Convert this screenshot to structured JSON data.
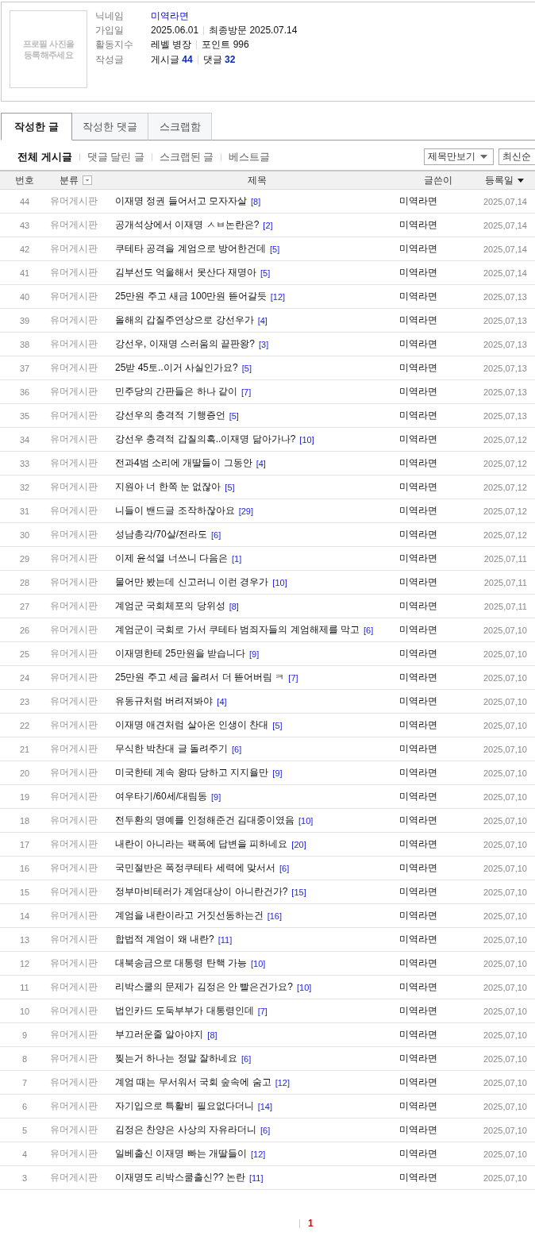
{
  "profile": {
    "photo_placeholder": "프로필 사진을 등록해주세요",
    "fields": [
      {
        "label": "닉네임",
        "kind": "link",
        "value": "미역라면"
      },
      {
        "label": "가입일",
        "kind": "parts",
        "parts": [
          "2025.06.01",
          "최종방문 2025.07.14"
        ]
      },
      {
        "label": "활동지수",
        "kind": "parts",
        "parts": [
          "레벨 병장",
          "포인트 996"
        ]
      },
      {
        "label": "작성글",
        "kind": "parts",
        "parts": [
          "게시글 **44**",
          "댓글 **32**"
        ]
      }
    ]
  },
  "tabs": [
    {
      "label": "작성한 글",
      "selected": true
    },
    {
      "label": "작성한 댓글",
      "selected": false
    },
    {
      "label": "스크랩함",
      "selected": false
    }
  ],
  "filters": [
    {
      "label": "전체 게시글",
      "selected": true
    },
    {
      "label": "댓글 달린 글",
      "selected": false
    },
    {
      "label": "스크랩된 글",
      "selected": false
    },
    {
      "label": "베스트글",
      "selected": false
    }
  ],
  "selects": [
    {
      "value": "제목만보기"
    },
    {
      "value": "최신순"
    }
  ],
  "table": {
    "columns": [
      {
        "label": "번호",
        "kind": "plain"
      },
      {
        "label": "분류",
        "kind": "filter"
      },
      {
        "label": "제목",
        "kind": "plain"
      },
      {
        "label": "글쓴이",
        "kind": "plain"
      },
      {
        "label": "등록일",
        "kind": "sort"
      }
    ],
    "rows": [
      {
        "number": "44",
        "category": "유머게시판",
        "title": "이재명 정권 들어서고 모자자살",
        "comments": "[8]",
        "author": "미역라면",
        "date": "2025,07,14"
      },
      {
        "number": "43",
        "category": "유머게시판",
        "title": "공개석상에서 이재명 ㅅㅂ논란은?",
        "comments": "[2]",
        "author": "미역라면",
        "date": "2025,07,14"
      },
      {
        "number": "42",
        "category": "유머게시판",
        "title": "쿠테타 공격을 계엄으로 방어한건데",
        "comments": "[5]",
        "author": "미역라면",
        "date": "2025,07,14"
      },
      {
        "number": "41",
        "category": "유머게시판",
        "title": "김부선도 억울해서 못산다 재명아",
        "comments": "[5]",
        "author": "미역라면",
        "date": "2025,07,14"
      },
      {
        "number": "40",
        "category": "유머게시판",
        "title": "25만원 주고 새금 100만원 뜯어갈듯",
        "comments": "[12]",
        "author": "미역라면",
        "date": "2025,07,13"
      },
      {
        "number": "39",
        "category": "유머게시판",
        "title": "올해의 갑질주연상으로 강선우가",
        "comments": "[4]",
        "author": "미역라면",
        "date": "2025,07,13"
      },
      {
        "number": "38",
        "category": "유머게시판",
        "title": "강선우, 이재명 스러움의 끝판왕?",
        "comments": "[3]",
        "author": "미역라면",
        "date": "2025,07,13"
      },
      {
        "number": "37",
        "category": "유머게시판",
        "title": "25받 45토..이거 사실인가요?",
        "comments": "[5]",
        "author": "미역라면",
        "date": "2025,07,13"
      },
      {
        "number": "36",
        "category": "유머게시판",
        "title": "민주당의 간판들은 하나 같이",
        "comments": "[7]",
        "author": "미역라면",
        "date": "2025,07,13"
      },
      {
        "number": "35",
        "category": "유머게시판",
        "title": "강선우의 충격적 기행증언",
        "comments": "[5]",
        "author": "미역라면",
        "date": "2025,07,13"
      },
      {
        "number": "34",
        "category": "유머게시판",
        "title": "강선우 충격적 갑질의혹..이재명 닮아가나?",
        "comments": "[10]",
        "author": "미역라면",
        "date": "2025,07,12"
      },
      {
        "number": "33",
        "category": "유머게시판",
        "title": "전과4범 소리에 개딸들이 그동안",
        "comments": "[4]",
        "author": "미역라면",
        "date": "2025,07,12"
      },
      {
        "number": "32",
        "category": "유머게시판",
        "title": "지원아 너 한쪽 눈 없잖아",
        "comments": "[5]",
        "author": "미역라면",
        "date": "2025,07,12"
      },
      {
        "number": "31",
        "category": "유머게시판",
        "title": "니들이 밴드글 조작하잖아요",
        "comments": "[29]",
        "author": "미역라면",
        "date": "2025,07,12"
      },
      {
        "number": "30",
        "category": "유머게시판",
        "title": "성남총각/70살/전라도",
        "comments": "[6]",
        "author": "미역라면",
        "date": "2025,07,12"
      },
      {
        "number": "29",
        "category": "유머게시판",
        "title": "이제 윤석열 너쓰니 다음은",
        "comments": "[1]",
        "author": "미역라면",
        "date": "2025,07,11"
      },
      {
        "number": "28",
        "category": "유머게시판",
        "title": "물어만 봤는데 신고러니 이런 경우가",
        "comments": "[10]",
        "author": "미역라면",
        "date": "2025,07,11"
      },
      {
        "number": "27",
        "category": "유머게시판",
        "title": "계엄군 국회체포의 당위성",
        "comments": "[8]",
        "author": "미역라면",
        "date": "2025,07,11"
      },
      {
        "number": "26",
        "category": "유머게시판",
        "title": "계엄군이 국회로 가서 쿠테타 범죄자들의 계엄해제를 막고",
        "comments": "[6]",
        "author": "미역라면",
        "date": "2025,07,10"
      },
      {
        "number": "25",
        "category": "유머게시판",
        "title": "이재명한테 25만원을 받습니다",
        "comments": "[9]",
        "author": "미역라면",
        "date": "2025,07,10"
      },
      {
        "number": "24",
        "category": "유머게시판",
        "title": "25만원 주고 세금 올려서 더 뜯어버림 ㅋ",
        "comments": "[7]",
        "author": "미역라면",
        "date": "2025,07,10"
      },
      {
        "number": "23",
        "category": "유머게시판",
        "title": "유동규처럼 버려져봐야",
        "comments": "[4]",
        "author": "미역라면",
        "date": "2025,07,10"
      },
      {
        "number": "22",
        "category": "유머게시판",
        "title": "이재명 애견처럼 살아온 인생이 찬대",
        "comments": "[5]",
        "author": "미역라면",
        "date": "2025,07,10"
      },
      {
        "number": "21",
        "category": "유머게시판",
        "title": "무식한 박찬대 글 돌려주기",
        "comments": "[6]",
        "author": "미역라면",
        "date": "2025,07,10"
      },
      {
        "number": "20",
        "category": "유머게시판",
        "title": "미국한테 계속 왕따 당하고 지지율만",
        "comments": "[9]",
        "author": "미역라면",
        "date": "2025,07,10"
      },
      {
        "number": "19",
        "category": "유머게시판",
        "title": "여우타기/60세/대림동",
        "comments": "[9]",
        "author": "미역라면",
        "date": "2025,07,10"
      },
      {
        "number": "18",
        "category": "유머게시판",
        "title": "전두환의 명예를 인정해준건 김대중이였음",
        "comments": "[10]",
        "author": "미역라면",
        "date": "2025,07,10"
      },
      {
        "number": "17",
        "category": "유머게시판",
        "title": "내란이 아니라는 팩폭에 답변을 피하네요",
        "comments": "[20]",
        "author": "미역라면",
        "date": "2025,07,10"
      },
      {
        "number": "16",
        "category": "유머게시판",
        "title": "국민절반은 폭정쿠테타 세력에 맞서서",
        "comments": "[6]",
        "author": "미역라면",
        "date": "2025,07,10"
      },
      {
        "number": "15",
        "category": "유머게시판",
        "title": "정부마비테러가 계엄대상이 아니란건가?",
        "comments": "[15]",
        "author": "미역라면",
        "date": "2025,07,10"
      },
      {
        "number": "14",
        "category": "유머게시판",
        "title": "계엄을 내란이라고 거짓선동하는건",
        "comments": "[16]",
        "author": "미역라면",
        "date": "2025,07,10"
      },
      {
        "number": "13",
        "category": "유머게시판",
        "title": "합법적 계엄이 왜 내란?",
        "comments": "[11]",
        "author": "미역라면",
        "date": "2025,07,10"
      },
      {
        "number": "12",
        "category": "유머게시판",
        "title": "대북송금으로 대통령 탄핵 가능",
        "comments": "[10]",
        "author": "미역라면",
        "date": "2025,07,10"
      },
      {
        "number": "11",
        "category": "유머게시판",
        "title": "리박스쿨의 문제가 김정은 안 빨은건가요?",
        "comments": "[10]",
        "author": "미역라면",
        "date": "2025,07,10"
      },
      {
        "number": "10",
        "category": "유머게시판",
        "title": "법인카드 도둑부부가 대통령인데",
        "comments": "[7]",
        "author": "미역라면",
        "date": "2025,07,10"
      },
      {
        "number": "9",
        "category": "유머게시판",
        "title": "부끄러운줄 알아야지",
        "comments": "[8]",
        "author": "미역라면",
        "date": "2025,07,10"
      },
      {
        "number": "8",
        "category": "유머게시판",
        "title": "찢는거 하나는 정말 잘하네요",
        "comments": "[6]",
        "author": "미역라면",
        "date": "2025,07,10"
      },
      {
        "number": "7",
        "category": "유머게시판",
        "title": "계엄 때는 무서워서 국회 숲속에 숨고",
        "comments": "[12]",
        "author": "미역라면",
        "date": "2025,07,10"
      },
      {
        "number": "6",
        "category": "유머게시판",
        "title": "자기입으로 특활비 필요없다더니",
        "comments": "[14]",
        "author": "미역라면",
        "date": "2025,07,10"
      },
      {
        "number": "5",
        "category": "유머게시판",
        "title": "김정은 찬양은 사상의 자유라더니",
        "comments": "[6]",
        "author": "미역라면",
        "date": "2025,07,10"
      },
      {
        "number": "4",
        "category": "유머게시판",
        "title": "일베출신 이재명 빠는 개딸들이",
        "comments": "[12]",
        "author": "미역라면",
        "date": "2025,07,10"
      },
      {
        "number": "3",
        "category": "유머게시판",
        "title": "이재명도 리박스쿨출신?? 논란",
        "comments": "[11]",
        "author": "미역라면",
        "date": "2025,07,10"
      }
    ]
  },
  "pagination": {
    "pages": [
      {
        "label": "1",
        "selected": true
      }
    ]
  }
}
